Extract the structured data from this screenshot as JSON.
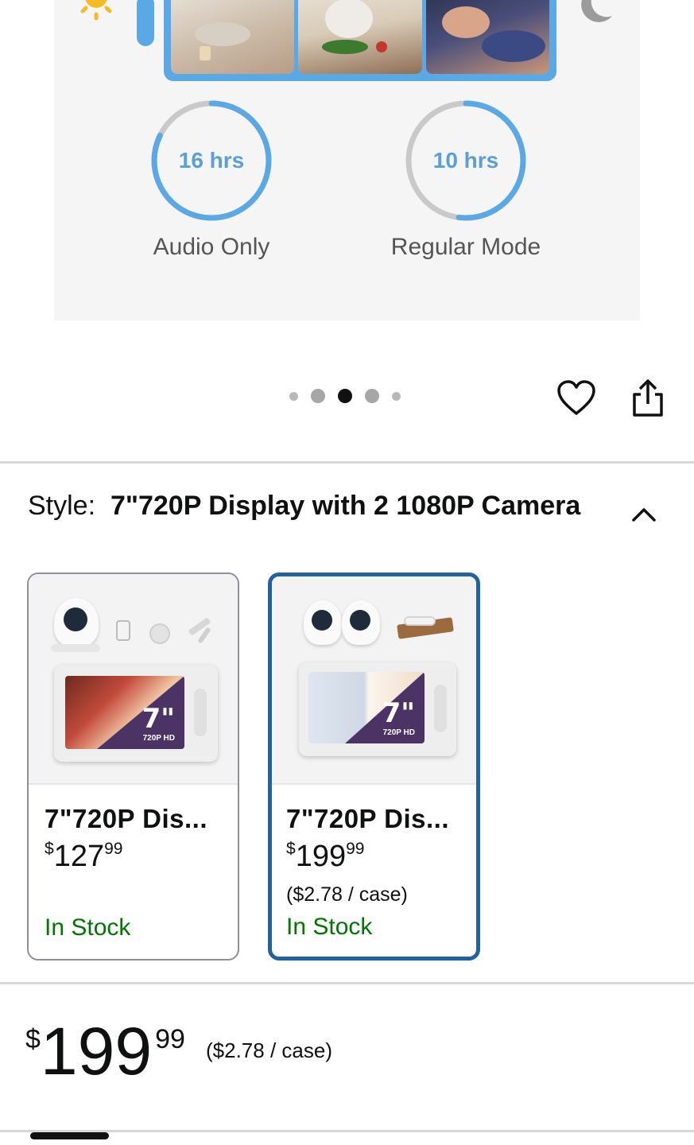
{
  "hero": {
    "rings": [
      {
        "value": "16 hrs",
        "label": "Audio Only"
      },
      {
        "value": "10 hrs",
        "label": "Regular Mode"
      }
    ]
  },
  "carousel": {
    "dot_count": 5,
    "active_index": 2
  },
  "style_selector": {
    "key": "Style:",
    "value": "7\"720P Display with 2 1080P Camera",
    "options": [
      {
        "title": "7\"720P Dis...",
        "price_symbol": "$",
        "price_whole": "127",
        "price_cents": "99",
        "unit_price": "",
        "stock": "In Stock",
        "selected": false
      },
      {
        "title": "7\"720P Dis...",
        "price_symbol": "$",
        "price_whole": "199",
        "price_cents": "99",
        "unit_price": "($2.78 / case)",
        "stock": "In Stock",
        "selected": true
      }
    ]
  },
  "price": {
    "symbol": "$",
    "whole": "199",
    "cents": "99",
    "unit": "($2.78 / case)"
  },
  "colors": {
    "accent_blue": "#5aa9e6",
    "selected_border": "#2162a1",
    "in_stock": "#007600"
  },
  "icons": [
    "sun-icon",
    "moon-icon",
    "heart-icon",
    "share-icon",
    "chevron-up-icon"
  ]
}
